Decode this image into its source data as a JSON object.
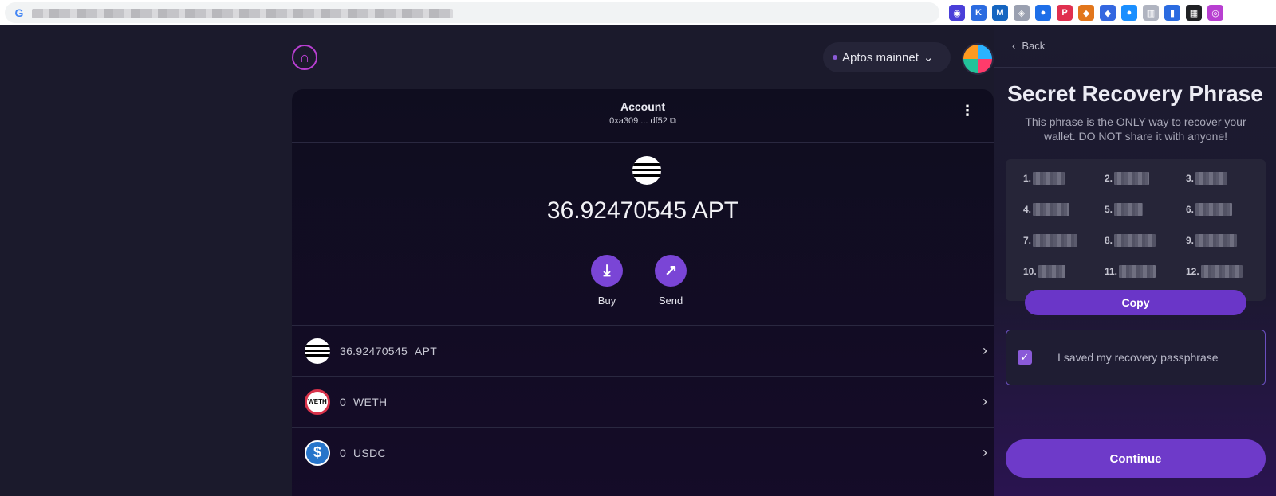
{
  "browser": {
    "extensions": [
      {
        "name": "ext-1-icon",
        "glyph": "◉",
        "color": "#4a3fd9"
      },
      {
        "name": "ext-k-icon",
        "glyph": "K",
        "color": "#2b6be0"
      },
      {
        "name": "ext-m-icon",
        "glyph": "M",
        "color": "#1565c0"
      },
      {
        "name": "ext-shield-icon",
        "glyph": "◈",
        "color": "#9aa0b0"
      },
      {
        "name": "ext-circle-icon",
        "glyph": "●",
        "color": "#1e6fe8"
      },
      {
        "name": "ext-p-icon",
        "glyph": "P",
        "color": "#e0304f"
      },
      {
        "name": "ext-fox-icon",
        "glyph": "◆",
        "color": "#e2761b"
      },
      {
        "name": "ext-diamond-icon",
        "glyph": "◆",
        "color": "#3467e0"
      },
      {
        "name": "ext-swirl-icon",
        "glyph": "●",
        "color": "#1a8fff"
      },
      {
        "name": "ext-book-icon",
        "glyph": "▥",
        "color": "#b0b4c0"
      },
      {
        "name": "ext-bookmark-icon",
        "glyph": "▮",
        "color": "#2b6be0"
      },
      {
        "name": "ext-grid-icon",
        "glyph": "▦",
        "color": "#202124"
      },
      {
        "name": "ext-petra-icon",
        "glyph": "◎",
        "color": "#b83fd1"
      }
    ]
  },
  "header": {
    "network": "Aptos mainnet",
    "network_chevron": "⌄",
    "logo_glyph": "∩"
  },
  "account": {
    "title": "Account",
    "address": "0xa309 ... df52",
    "copy_glyph": "⧉",
    "kebab_glyph": "⋮",
    "balance": "36.92470545 APT",
    "actions": [
      {
        "label": "Buy",
        "glyph": "⤓"
      },
      {
        "label": "Send",
        "glyph": "↗"
      }
    ]
  },
  "tokens": [
    {
      "amount": "36.92470545",
      "symbol": "APT",
      "icon": "aptos-icon"
    },
    {
      "amount": "0",
      "symbol": "WETH",
      "icon": "weth-icon",
      "icon_text": "WETH"
    },
    {
      "amount": "0",
      "symbol": "USDC",
      "icon": "usdc-icon",
      "icon_text": "$"
    }
  ],
  "popup": {
    "back_label": "Back",
    "title": "Secret Recovery Phrase",
    "subtitle": "This phrase is the ONLY way to recover your wallet. DO NOT share it with anyone!",
    "words": [
      "1.",
      "2.",
      "3.",
      "4.",
      "5.",
      "6.",
      "7.",
      "8.",
      "9.",
      "10.",
      "11.",
      "12."
    ],
    "copy_label": "Copy",
    "saved_label": "I saved my recovery passphrase",
    "saved_checked": true,
    "continue_label": "Continue"
  }
}
